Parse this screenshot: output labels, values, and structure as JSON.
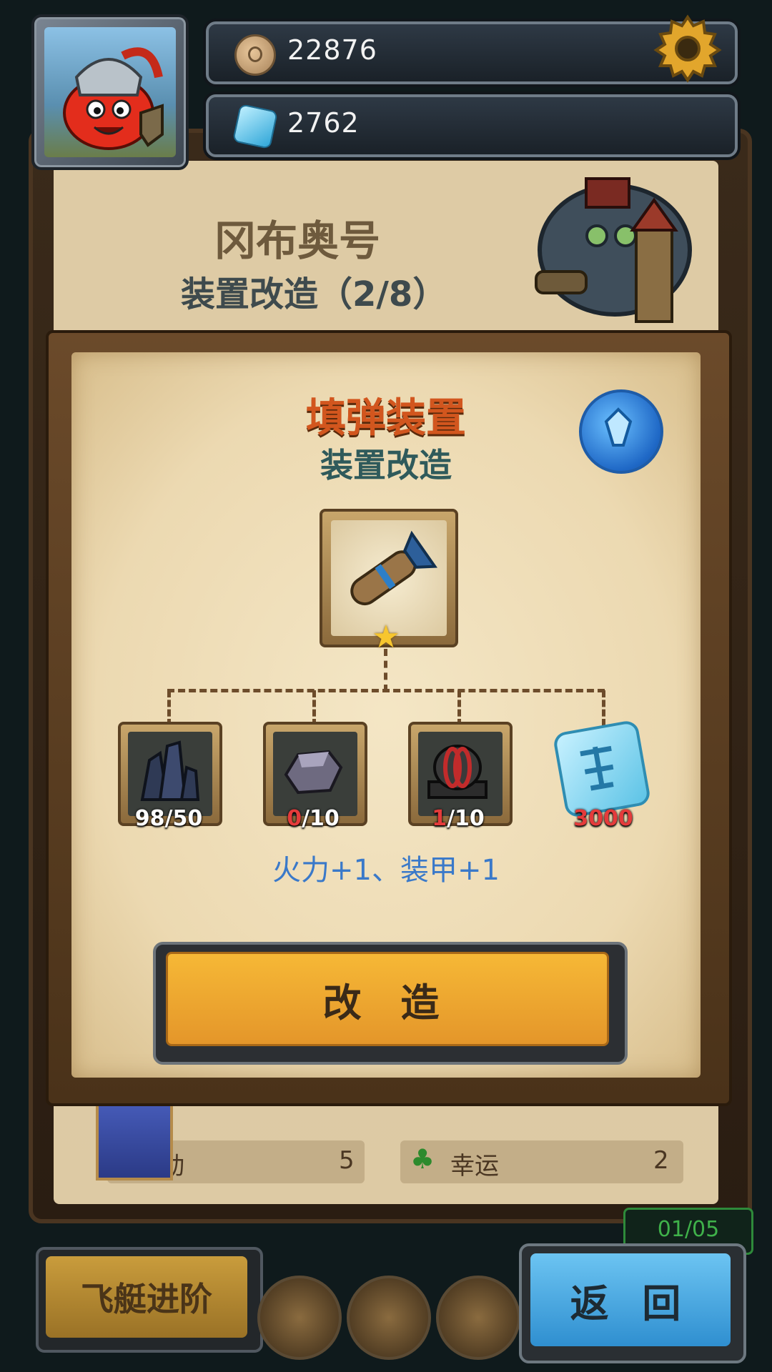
{
  "currency": {
    "coins": "22876",
    "gems": "2762"
  },
  "header": {
    "ship_name": "冈布奥号",
    "subtitle": "装置改造（2/8）"
  },
  "modal": {
    "title": "填弹装置",
    "subtitle": "装置改造",
    "star": "★",
    "materials": [
      {
        "name": "crystal-ore",
        "have": "98",
        "need": "/50",
        "enough": true
      },
      {
        "name": "stone-chunk",
        "have": "0",
        "need": "/10",
        "enough": false
      },
      {
        "name": "coil-part",
        "have": "1",
        "need": "/10",
        "enough": false
      },
      {
        "name": "rune-stone",
        "count": "3000",
        "enough": false
      }
    ],
    "bonus": "火力+1、装甲+1",
    "upgrade_label": "改 造"
  },
  "background_list": {
    "row1_left_label": "机动",
    "row1_left_value": "5",
    "row1_right_label": "幸运",
    "row1_right_value": "2",
    "timer": "01/05"
  },
  "bottom_nav": {
    "advance_label": "飞艇进阶",
    "back_label": "返 回"
  },
  "colors": {
    "accent_orange": "#f6b836",
    "accent_blue": "#3a79c9",
    "title_orange": "#d2561e",
    "insufficient_red": "#e43b3b"
  }
}
